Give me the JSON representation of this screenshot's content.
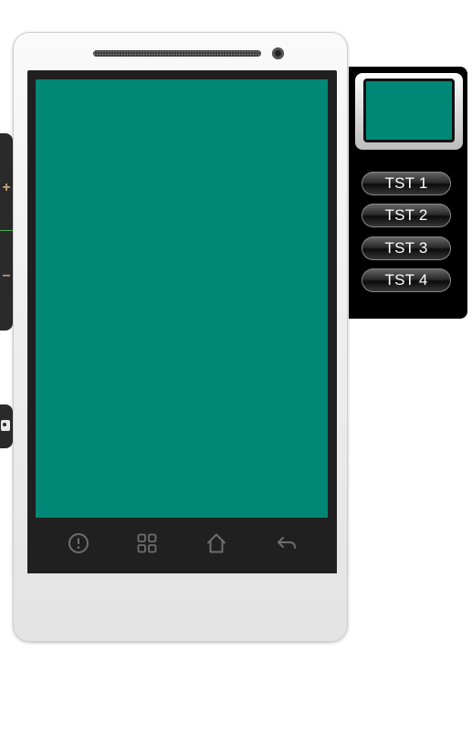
{
  "emulator": {
    "screen_color": "#008776",
    "volume": {
      "up_label": "+",
      "down_label": "–"
    },
    "nav_buttons": [
      {
        "icon": "menu-info-icon"
      },
      {
        "icon": "apps-grid-icon"
      },
      {
        "icon": "home-icon"
      },
      {
        "icon": "back-arrow-icon"
      }
    ]
  },
  "panel": {
    "preview_color": "#008776",
    "buttons": [
      {
        "label": "TST 1"
      },
      {
        "label": "TST 2"
      },
      {
        "label": "TST 3"
      },
      {
        "label": "TST 4"
      }
    ]
  }
}
